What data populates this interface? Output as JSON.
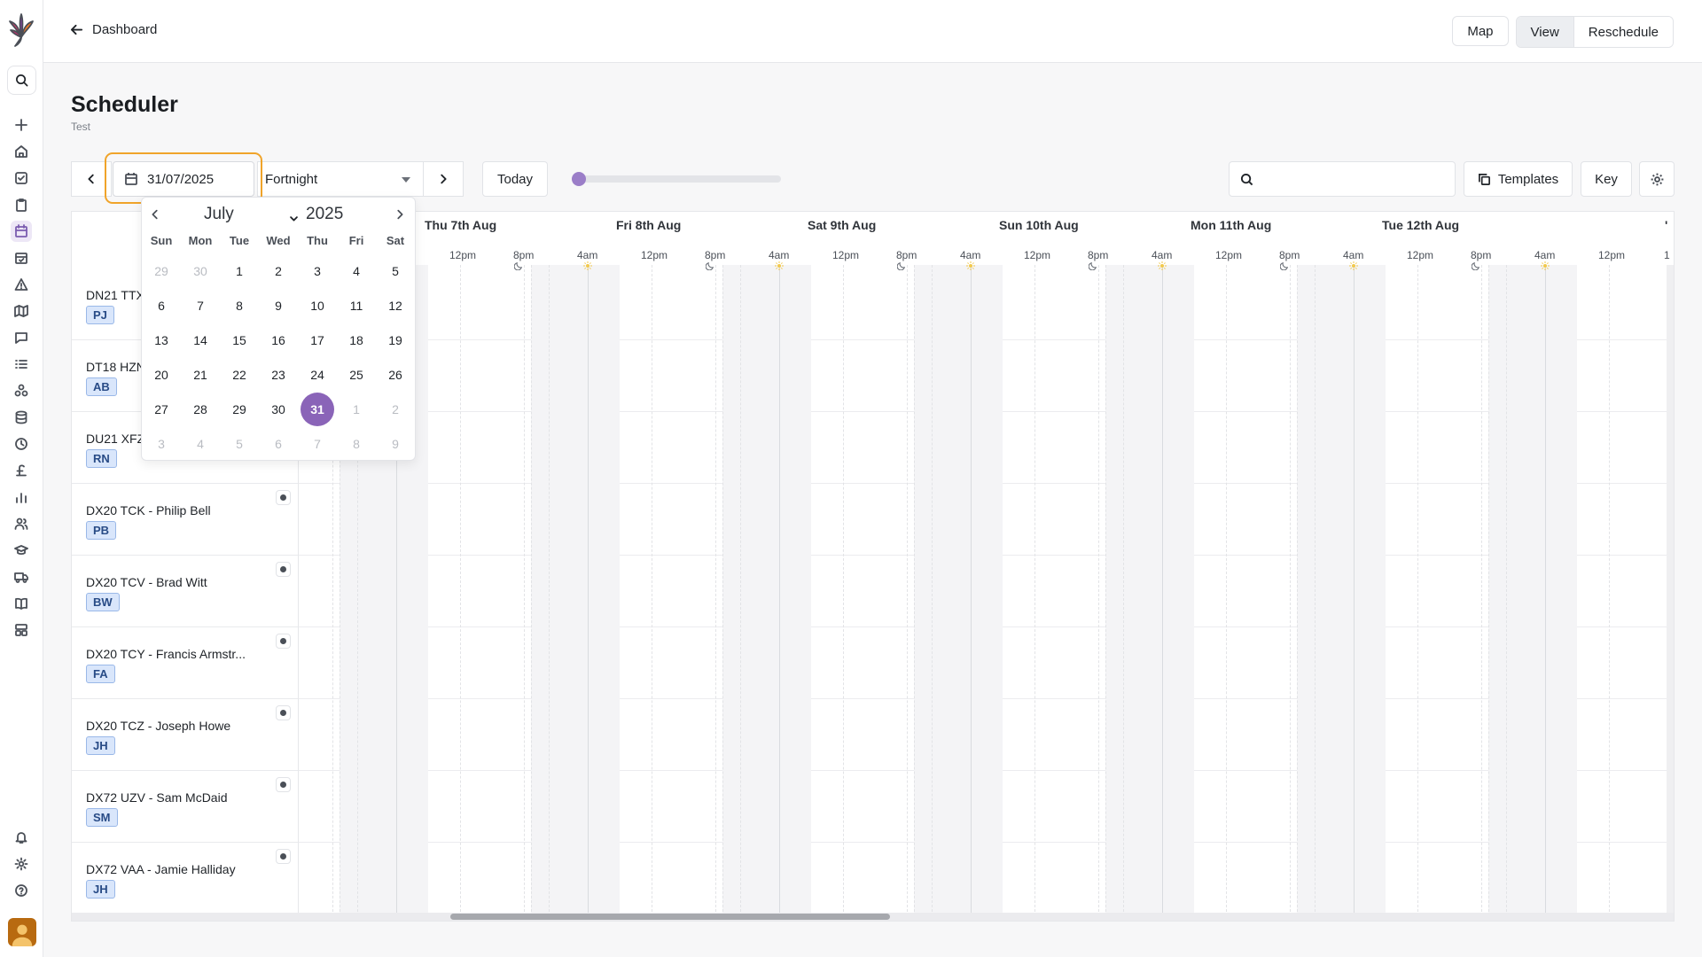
{
  "topbar": {
    "back_label": "Dashboard",
    "buttons": {
      "map": "Map",
      "view": "View",
      "reschedule": "Reschedule"
    }
  },
  "page": {
    "title": "Scheduler",
    "subtitle": "Test"
  },
  "toolbar": {
    "date_value": "31/07/2025",
    "period": "Fortnight",
    "today_label": "Today",
    "search_placeholder": "",
    "templates_label": "Templates",
    "key_label": "Key"
  },
  "timeline": {
    "days": [
      "Thu 7th Aug",
      "Fri 8th Aug",
      "Sat 9th Aug",
      "Sun 10th Aug",
      "Mon 11th Aug",
      "Tue 12th Aug"
    ],
    "hours": [
      "4am",
      "12pm",
      "8pm"
    ],
    "partial_hour": "1",
    "partial_day": "'"
  },
  "resources": [
    {
      "name": "DN21 TTX",
      "initials": "PJ"
    },
    {
      "name": "DT18 HZN",
      "initials": "AB"
    },
    {
      "name": "DU21 XFZ",
      "initials": "RN"
    },
    {
      "name": "DX20 TCK - Philip Bell",
      "initials": "PB"
    },
    {
      "name": "DX20 TCV - Brad Witt",
      "initials": "BW"
    },
    {
      "name": "DX20 TCY - Francis Armstr...",
      "initials": "FA"
    },
    {
      "name": "DX20 TCZ - Joseph Howe",
      "initials": "JH"
    },
    {
      "name": "DX72 UZV - Sam McDaid",
      "initials": "SM"
    },
    {
      "name": "DX72 VAA - Jamie Halliday",
      "initials": "JH"
    }
  ],
  "datepicker": {
    "month": "July",
    "year": "2025",
    "weekdays": [
      "Sun",
      "Mon",
      "Tue",
      "Wed",
      "Thu",
      "Fri",
      "Sat"
    ],
    "weeks": [
      [
        "29",
        "30",
        "1",
        "2",
        "3",
        "4",
        "5"
      ],
      [
        "6",
        "7",
        "8",
        "9",
        "10",
        "11",
        "12"
      ],
      [
        "13",
        "14",
        "15",
        "16",
        "17",
        "18",
        "19"
      ],
      [
        "20",
        "21",
        "22",
        "23",
        "24",
        "25",
        "26"
      ],
      [
        "27",
        "28",
        "29",
        "30",
        "31",
        "1",
        "2"
      ],
      [
        "3",
        "4",
        "5",
        "6",
        "7",
        "8",
        "9"
      ]
    ],
    "selected": "31"
  },
  "sidebar_icons": [
    "search-icon",
    "plus-icon",
    "home-icon",
    "check-square-icon",
    "clipboard-icon",
    "calendar-icon",
    "calendar-check-icon",
    "warning-icon",
    "map-icon",
    "chat-icon",
    "list-icon",
    "network-icon",
    "database-icon",
    "clock-icon",
    "pound-icon",
    "bar-chart-icon",
    "users-icon",
    "graduation-cap-icon",
    "truck-icon",
    "book-icon",
    "layout-icon",
    "bell-icon",
    "gear-icon",
    "help-icon"
  ],
  "colors": {
    "accent": "#8a64b8",
    "focus_ring": "#f0a42a",
    "badge_bg": "#d9e6fb",
    "badge_border": "#9ab8e8"
  }
}
